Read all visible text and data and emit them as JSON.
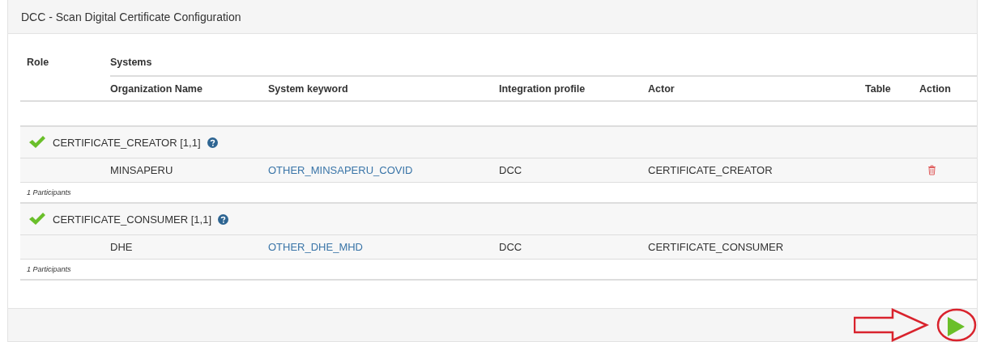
{
  "panel": {
    "title": "DCC - Scan Digital Certificate Configuration"
  },
  "table": {
    "columns": {
      "role": "Role",
      "systems": "Systems",
      "sub": [
        "Organization Name",
        "System keyword",
        "Integration profile",
        "Actor",
        "Table",
        "Action"
      ]
    },
    "groups": [
      {
        "role": "CERTIFICATE_CREATOR [1,1]",
        "complete": true,
        "rows": [
          {
            "organization": "MINSAPERU",
            "keyword": "OTHER_MINSAPERU_COVID",
            "profile": "DCC",
            "actor": "CERTIFICATE_CREATOR",
            "deletable": true
          }
        ],
        "footer": "1 Participants"
      },
      {
        "role": "CERTIFICATE_CONSUMER [1,1]",
        "complete": true,
        "rows": [
          {
            "organization": "DHE",
            "keyword": "OTHER_DHE_MHD",
            "profile": "DCC",
            "actor": "CERTIFICATE_CONSUMER",
            "deletable": false
          }
        ],
        "footer": "1 Participants"
      }
    ]
  },
  "footer": {
    "annotation": true
  }
}
